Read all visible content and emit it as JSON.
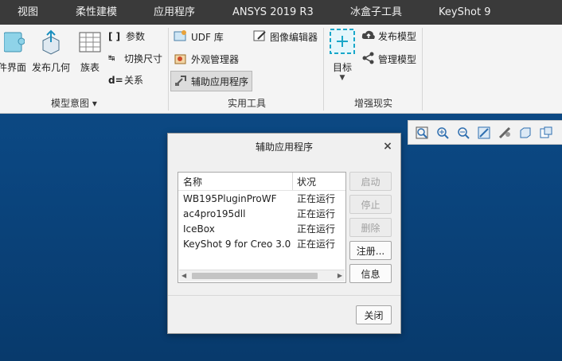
{
  "menubar": {
    "tabs": [
      "视图",
      "柔性建模",
      "应用程序",
      "ANSYS 2019 R3",
      "冰盒子工具",
      "KeyShot 9"
    ]
  },
  "ribbon": {
    "model_intent": {
      "group_label": "模型意图",
      "partial_label": "件界面",
      "publish_geometry": "发布几何",
      "family_table": "族表",
      "parameters": "参数",
      "switch_dimensions": "切换尺寸",
      "relations": "关系"
    },
    "utilities": {
      "group_label": "实用工具",
      "udf_library": "UDF 库",
      "image_editor": "图像编辑器",
      "appearance_manager": "外观管理器",
      "auxiliary_apps": "辅助应用程序"
    },
    "augmented_reality": {
      "group_label": "增强现实",
      "target": "目标",
      "publish_model": "发布模型",
      "manage_model": "管理模型"
    }
  },
  "dialog": {
    "title": "辅助应用程序",
    "columns": [
      "名称",
      "状况"
    ],
    "rows": [
      {
        "name": "WB195PluginProWF",
        "status": "正在运行"
      },
      {
        "name": "ac4pro195dll",
        "status": "正在运行"
      },
      {
        "name": "IceBox",
        "status": "正在运行"
      },
      {
        "name": "KeyShot 9 for Creo 3.0",
        "status": "正在运行"
      }
    ],
    "buttons": {
      "start": "启动",
      "stop": "停止",
      "delete": "删除",
      "register": "注册...",
      "info": "信息",
      "close": "关闭"
    }
  },
  "colors": {
    "menubar_bg": "#3a3a3a",
    "ribbon_bg": "#f4f4f4",
    "workspace_bg": "#0b4680",
    "accent_cyan": "#18a7c9"
  },
  "icons": [
    "puzzle-icon",
    "publish-geometry-icon",
    "family-table-icon",
    "parameters-icon",
    "switch-dimensions-icon",
    "relations-icon",
    "udf-library-icon",
    "image-editor-icon",
    "appearance-manager-icon",
    "auxiliary-apps-icon",
    "target-icon",
    "cloud-upload-icon",
    "share-icon"
  ]
}
